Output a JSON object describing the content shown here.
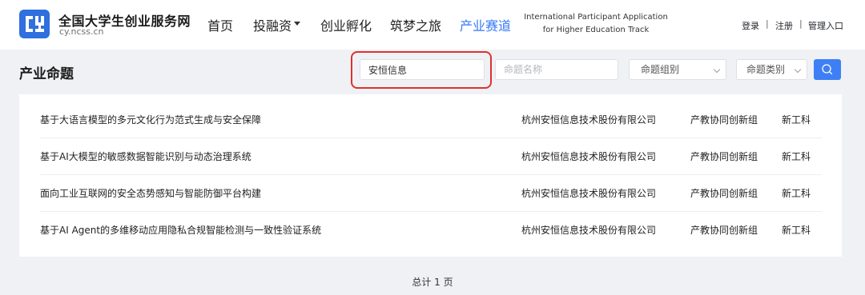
{
  "brand": {
    "name": "全国大学生创业服务网",
    "domain": "cy.ncss.cn",
    "logo_color": "#2f6fde",
    "logo_text": "CY"
  },
  "nav": {
    "items": [
      {
        "label": "首页"
      },
      {
        "label": "投融资",
        "has_dropdown": true
      },
      {
        "label": "创业孵化"
      },
      {
        "label": "筑梦之旅"
      },
      {
        "label": "产业赛道",
        "active": true
      }
    ],
    "intl_line1": "International Participant Application",
    "intl_line2": "for Higher Education Track",
    "active_color": "#3579f6"
  },
  "auth": {
    "login": "登录",
    "register": "注册",
    "admin": "管理入口",
    "separator": "|"
  },
  "page": {
    "title": "产业命题"
  },
  "filters": {
    "company_value": "安恒信息",
    "topic_placeholder": "命题名称",
    "group_select": "命题组别",
    "category_select": "命题类别",
    "search_icon": "search-icon",
    "highlight_color": "#e0302d"
  },
  "table": {
    "rows": [
      {
        "title": "基于大语言模型的多元文化行为范式生成与安全保障",
        "company": "杭州安恒信息技术股份有限公司",
        "group": "产教协同创新组",
        "category": "新工科"
      },
      {
        "title": "基于AI大模型的敏感数据智能识别与动态治理系统",
        "company": "杭州安恒信息技术股份有限公司",
        "group": "产教协同创新组",
        "category": "新工科"
      },
      {
        "title": "面向工业互联网的安全态势感知与智能防御平台构建",
        "company": "杭州安恒信息技术股份有限公司",
        "group": "产教协同创新组",
        "category": "新工科"
      },
      {
        "title": "基于AI Agent的多维移动应用隐私合规智能检测与一致性验证系统",
        "company": "杭州安恒信息技术股份有限公司",
        "group": "产教协同创新组",
        "category": "新工科"
      }
    ]
  },
  "pagination": {
    "total_text": "总计 1 页"
  }
}
